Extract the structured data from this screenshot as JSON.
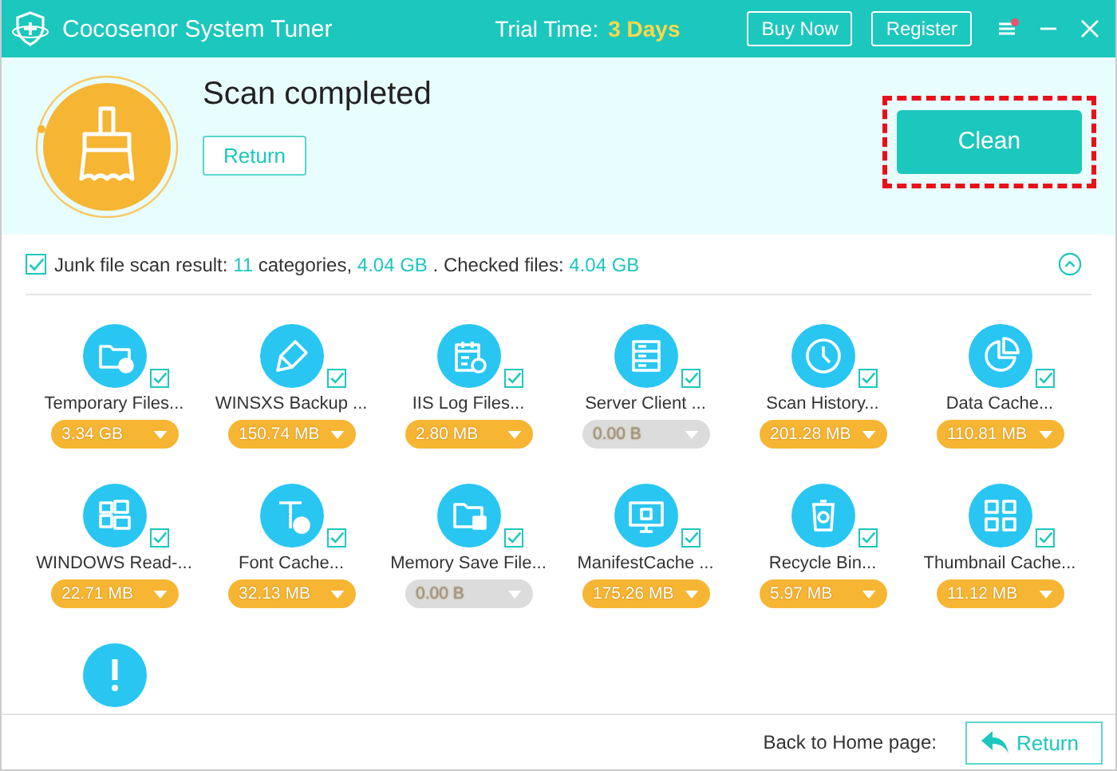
{
  "window": {
    "title": "Cocosenor System Tuner",
    "trial_label": "Trial Time:",
    "trial_value": "3 Days",
    "buttons": [
      "Buy Now",
      "Register"
    ],
    "has_notification": true
  },
  "header": {
    "status": "Scan completed",
    "return_button": "Return",
    "clean_button": "Clean",
    "clean_highlighted": true
  },
  "summary": {
    "checked": true,
    "text": "Junk file scan result: ",
    "count": "11",
    "count_suffix": " categories, ",
    "size": "4.04 GB",
    "checked_label": " . Checked files: ",
    "checked_size": "4.04 GB",
    "expanded": true
  },
  "items": [
    {
      "kind": "folder-clock",
      "label": "Temporary Files...",
      "size": "3.34 GB",
      "checked": true,
      "disabled": false
    },
    {
      "kind": "brush",
      "label": "WINSXS Backup ...",
      "size": "150.74 MB",
      "checked": true,
      "disabled": false
    },
    {
      "kind": "calendar",
      "label": "IIS Log Files...",
      "size": "2.80 MB",
      "checked": true,
      "disabled": false
    },
    {
      "kind": "server",
      "label": "Server Client ...",
      "size": "0.00 B",
      "checked": true,
      "disabled": true
    },
    {
      "kind": "clock",
      "label": "Scan History...",
      "size": "201.28 MB",
      "checked": true,
      "disabled": false
    },
    {
      "kind": "pie",
      "label": "Data Cache...",
      "size": "110.81 MB",
      "checked": true,
      "disabled": false
    },
    {
      "kind": "windows",
      "label": "WINDOWS Read-...",
      "size": "22.71 MB",
      "checked": true,
      "disabled": false
    },
    {
      "kind": "font",
      "label": "Font Cache...",
      "size": "32.13 MB",
      "checked": true,
      "disabled": false
    },
    {
      "kind": "folder-disk",
      "label": "Memory Save File...",
      "size": "0.00 B",
      "checked": true,
      "disabled": true
    },
    {
      "kind": "monitor",
      "label": "ManifestCache ...",
      "size": "175.26 MB",
      "checked": true,
      "disabled": false
    },
    {
      "kind": "bin",
      "label": "Recycle Bin...",
      "size": "5.97 MB",
      "checked": true,
      "disabled": false
    },
    {
      "kind": "grid",
      "label": "Thumbnail Cache...",
      "size": "11.12 MB",
      "checked": true,
      "disabled": false
    },
    {
      "kind": "alert"
    }
  ],
  "footer": {
    "label": "Back to Home page:",
    "return_button": "Return"
  }
}
